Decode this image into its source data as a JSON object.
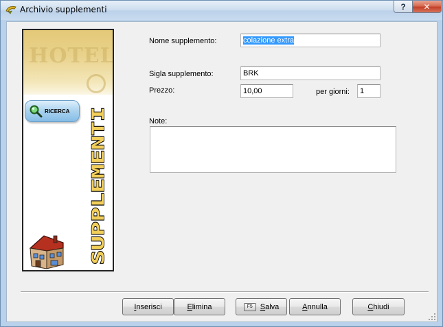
{
  "window": {
    "title": "Archivio supplementi",
    "help_label": "?",
    "close_label": "✕"
  },
  "side_panel": {
    "hotel_label": "HOTEL",
    "search_button_label": "RICERCA",
    "vertical_title": "SUPPLEMENTI"
  },
  "form": {
    "name_label": "Nome supplemento:",
    "name_value": "colazione extra",
    "code_label": "Sigla supplemento:",
    "code_value": "BRK",
    "price_label": "Prezzo:",
    "price_value": "10,00",
    "per_days_label": "per giorni:",
    "per_days_value": "1",
    "notes_label": "Note:",
    "notes_value": ""
  },
  "buttons": {
    "insert": {
      "first": "I",
      "rest": "nserisci"
    },
    "delete": {
      "first": "E",
      "rest": "limina"
    },
    "save": {
      "first": "S",
      "rest": "alva",
      "key": "F5"
    },
    "cancel": {
      "first": "A",
      "rest": "nnulla"
    },
    "close": {
      "first": "C",
      "rest": "hiudi"
    }
  }
}
